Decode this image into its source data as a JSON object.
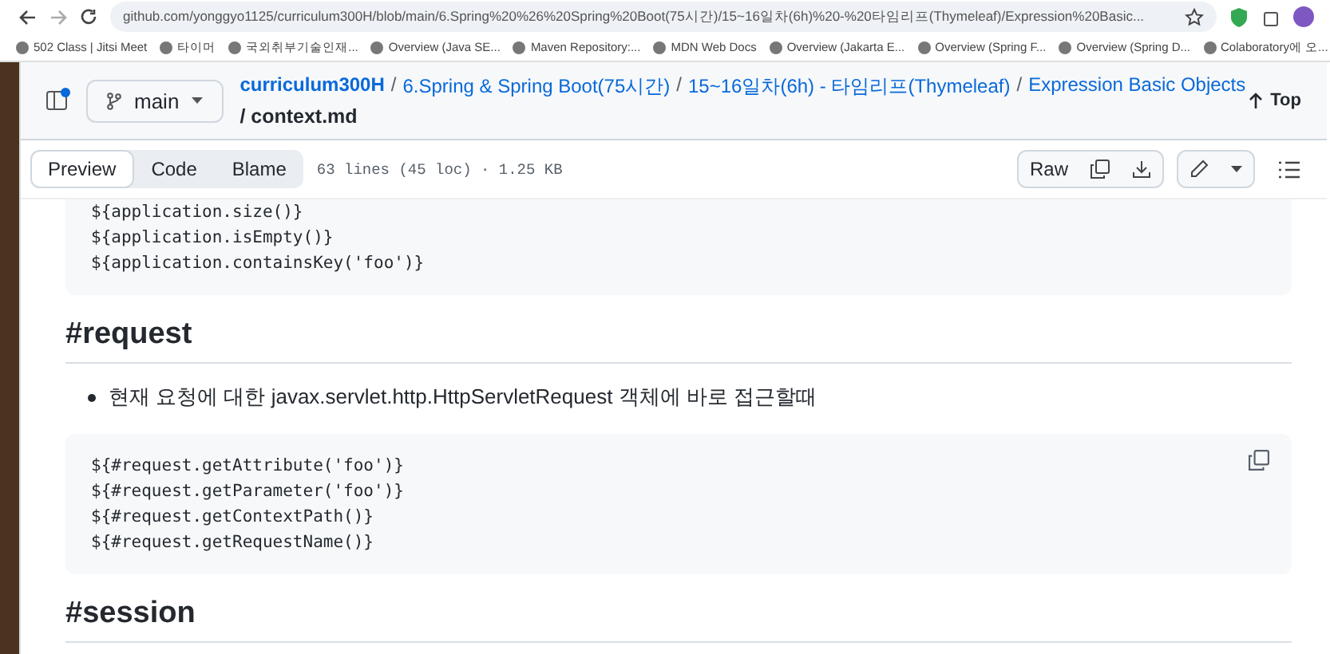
{
  "browser": {
    "url": "github.com/yonggyo1125/curriculum300H/blob/main/6.Spring%20%26%20Spring%20Boot(75시간)/15~16일차(6h)%20-%20타임리프(Thymeleaf)/Expression%20Basic...",
    "bookmarks": [
      "502 Class | Jitsi Meet",
      "타이머",
      "국외취부기술인재...",
      "Overview (Java SE...",
      "Maven Repository:...",
      "MDN Web Docs",
      "Overview (Jakarta E...",
      "Overview (Spring F...",
      "Overview (Spring D...",
      "Colaboratory에 오..."
    ]
  },
  "header": {
    "branch": "main",
    "separator": "/",
    "breadcrumb": [
      "curriculum300H",
      "6.Spring & Spring Boot(75시간)",
      "15~16일차(6h) - 타임리프(Thymeleaf)",
      "Expression Basic Objects"
    ],
    "file": "/ context.md",
    "top": "Top"
  },
  "tabs": [
    {
      "label": "Preview",
      "selected": true
    },
    {
      "label": "Code",
      "selected": false
    },
    {
      "label": "Blame",
      "selected": false
    }
  ],
  "file_info": "63 lines (45 loc) · 1.25 KB",
  "raw": "Raw",
  "content": [
    {
      "kind": "code",
      "lines": [
        "${application.size()}",
        "${application.isEmpty()}",
        "${application.containsKey('foo')}"
      ],
      "copy": false
    },
    {
      "kind": "heading",
      "text": "#request"
    },
    {
      "kind": "bullet",
      "text": "현재 요청에 대한 javax.servlet.http.HttpServletRequest 객체에 바로 접근할때"
    },
    {
      "kind": "code",
      "lines": [
        "${#request.getAttribute('foo')}",
        "${#request.getParameter('foo')}",
        "${#request.getContextPath()}",
        "${#request.getRequestName()}"
      ],
      "copy": true
    },
    {
      "kind": "heading",
      "text": "#session"
    }
  ]
}
